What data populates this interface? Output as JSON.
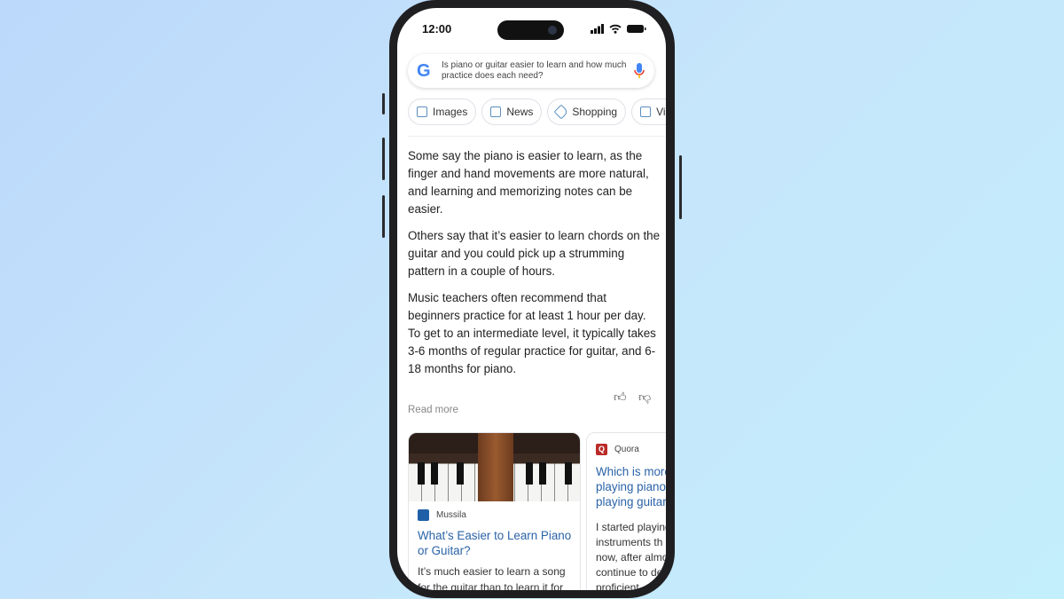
{
  "status": {
    "time": "12:00"
  },
  "search": {
    "query": "Is piano or guitar easier to learn and how much practice does each need?",
    "logo": "G"
  },
  "chips": [
    {
      "label": "Images",
      "icon": "image-icon"
    },
    {
      "label": "News",
      "icon": "news-icon"
    },
    {
      "label": "Shopping",
      "icon": "tag-icon"
    },
    {
      "label": "Videos",
      "icon": "play-icon"
    }
  ],
  "answer": {
    "paragraphs": [
      "Some say the piano is easier to learn, as the finger and hand movements are more natural, and learning and memorizing notes can be easier.",
      "Others say that it’s easier to learn chords on the guitar and you could pick up a strumming pattern in a couple of hours.",
      "Music teachers often recommend that beginners practice for at least 1 hour per day. To get to an intermediate level, it typically takes 3-6 months of regular practice for guitar, and 6-18 months for piano."
    ],
    "read_more": "Read more"
  },
  "cards": [
    {
      "source": "Mussila",
      "title_lines": [
        "What’s Easier to Learn Piano",
        "or Guitar?"
      ],
      "snippet_lines": [
        "It’s much easier to learn a song",
        "for the guitar than to learn it for"
      ],
      "logo_color": "#1f5fa8"
    },
    {
      "source": "Quora",
      "logo": "Q",
      "title_lines": [
        "Which is more",
        "playing piano",
        "playing guitar"
      ],
      "snippet_lines": [
        "I started playing",
        "instruments th",
        "now, after almo",
        "continue to de",
        "proficient"
      ],
      "logo_color": "#b92b27"
    }
  ],
  "colors": {
    "link": "#2b63a7",
    "accent": "#4285f4"
  }
}
